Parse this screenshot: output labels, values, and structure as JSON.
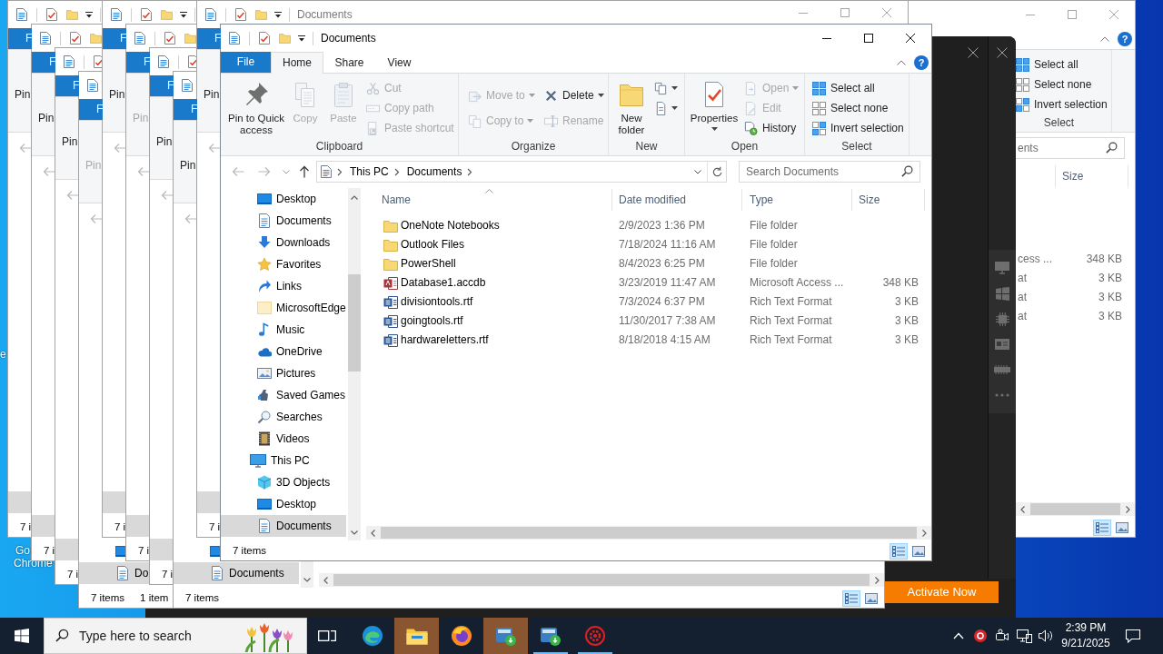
{
  "desktop_icons": [
    {
      "label_lines": [
        "e"
      ]
    },
    {
      "label_lines": [
        "Go",
        "Chrome"
      ]
    }
  ],
  "background_windows": [
    {
      "file_tab": "F",
      "ribbon_button": {
        "label": "Pin",
        "disabled": false
      },
      "nav_items": [
        {
          "selected": true
        }
      ],
      "status": [
        "7 i"
      ]
    },
    {
      "file_tab": "F",
      "ribbon_button": {
        "label": "Pin",
        "disabled": false
      },
      "nav_items": [
        {
          "selected": true
        }
      ],
      "status": [
        "7 i"
      ]
    },
    {
      "file_tab": "F",
      "ribbon_button": {
        "label": "Pin",
        "disabled": false
      },
      "nav_items": [
        {
          "selected": true
        }
      ],
      "status": [
        "7 i"
      ]
    },
    {
      "file_tab": "F",
      "ribbon_button": {
        "label": "Pin",
        "disabled": true
      },
      "nav_items": [
        {
          "selected": false
        },
        {
          "label": "Do",
          "selected": true
        }
      ],
      "status": [
        "7 items",
        "1 item"
      ]
    },
    {
      "file_tab": "F",
      "ribbon_button": {
        "label": "Pin",
        "disabled": false
      },
      "nav_items": [
        {
          "selected": true
        }
      ],
      "status": [
        "7 i"
      ]
    },
    {
      "file_tab": "F",
      "ribbon_button": {
        "label": "Pin",
        "disabled": true
      },
      "nav_items": [
        {
          "selected": true
        }
      ],
      "status": [
        "7 i"
      ]
    },
    {
      "file_tab": "F",
      "ribbon_button": {
        "label": "Pin",
        "disabled": false
      },
      "nav_items": [
        {
          "selected": true
        }
      ],
      "status": [
        "7 i"
      ]
    },
    {
      "file_tab": "F",
      "ribbon_button": {
        "label": "Pin",
        "disabled": false
      },
      "nav_items": [
        {
          "selected": false
        },
        {
          "label": "Documents",
          "selected": true
        }
      ],
      "status": [
        "7 items"
      ],
      "view_buttons": [
        {
          "selected": true
        },
        {
          "selected": false
        }
      ]
    },
    {
      "title": "Documents",
      "active": false,
      "file_tab": "F",
      "ribbon_button": {
        "label": "Pin",
        "disabled": false
      },
      "nav_items": [
        {
          "selected": true
        }
      ],
      "status": [
        "7 i"
      ]
    }
  ],
  "right_window": {
    "active": false,
    "help_button": "?",
    "ribbon_group": {
      "label": "Select",
      "buttons": [
        {
          "label": "Select all"
        },
        {
          "label": "Select none"
        },
        {
          "label": "Invert selection"
        }
      ]
    },
    "search": {
      "placeholder": "ents"
    },
    "columns": [
      {
        "label": "Size"
      }
    ],
    "rows": [
      {
        "type": "cess ...",
        "size": "348 KB",
        "selected": false
      },
      {
        "type": "at",
        "size": "3 KB",
        "selected": false
      },
      {
        "type": "at",
        "size": "3 KB",
        "selected": false
      },
      {
        "type": "at",
        "size": "3 KB",
        "selected": false
      }
    ],
    "view_buttons": [
      {
        "selected": true
      },
      {
        "selected": false
      }
    ]
  },
  "dark_app_window": {
    "action_button": "Activate Now"
  },
  "main_window": {
    "active": true,
    "title": "Documents",
    "help_button": "?",
    "tabs": [
      {
        "label": "File",
        "kind": "menu",
        "selected": false
      },
      {
        "label": "Home",
        "kind": "tab",
        "selected": true
      },
      {
        "label": "Share",
        "kind": "tab",
        "selected": false
      },
      {
        "label": "View",
        "kind": "tab",
        "selected": false
      }
    ],
    "ribbon": [
      {
        "label": "Clipboard",
        "buttons": [
          {
            "label": "Pin to Quick access",
            "kind": "large",
            "disabled": false,
            "dropdown": false
          },
          {
            "label": "Copy",
            "kind": "large",
            "disabled": true,
            "dropdown": false
          },
          {
            "label": "Paste",
            "kind": "large",
            "disabled": true,
            "dropdown": false
          },
          {
            "label": "Cut",
            "kind": "small",
            "disabled": true,
            "dropdown": false
          },
          {
            "label": "Copy path",
            "kind": "small",
            "disabled": true,
            "dropdown": false
          },
          {
            "label": "Paste shortcut",
            "kind": "small",
            "disabled": true,
            "dropdown": false
          }
        ]
      },
      {
        "label": "Organize",
        "buttons": [
          {
            "label": "Move to",
            "kind": "small",
            "disabled": true,
            "dropdown": true
          },
          {
            "label": "Copy to",
            "kind": "small",
            "disabled": true,
            "dropdown": true
          },
          {
            "label": "Delete",
            "kind": "small",
            "disabled": false,
            "dropdown": true
          },
          {
            "label": "Rename",
            "kind": "small",
            "disabled": true,
            "dropdown": false
          }
        ]
      },
      {
        "label": "New",
        "buttons": [
          {
            "label": "New folder",
            "kind": "large",
            "disabled": false,
            "dropdown": false
          },
          {
            "kind": "icon",
            "disabled": false,
            "dropdown": true
          },
          {
            "kind": "icon",
            "disabled": false,
            "dropdown": true
          }
        ]
      },
      {
        "label": "Open",
        "buttons": [
          {
            "label": "Properties",
            "kind": "large",
            "disabled": false,
            "dropdown": true
          },
          {
            "label": "Open",
            "kind": "small",
            "disabled": true,
            "dropdown": true
          },
          {
            "label": "Edit",
            "kind": "small",
            "disabled": true,
            "dropdown": false
          },
          {
            "label": "History",
            "kind": "small",
            "disabled": false,
            "dropdown": false
          }
        ]
      },
      {
        "label": "Select",
        "buttons": [
          {
            "label": "Select all",
            "kind": "small",
            "disabled": false,
            "dropdown": false
          },
          {
            "label": "Select none",
            "kind": "small",
            "disabled": false,
            "dropdown": false
          },
          {
            "label": "Invert selection",
            "kind": "small",
            "disabled": false,
            "dropdown": false
          }
        ]
      }
    ],
    "address": {
      "path": [
        "This PC",
        "Documents"
      ]
    },
    "search": {
      "placeholder": "Search Documents"
    },
    "nav_pane": [
      {
        "children": [
          {
            "label": "Desktop",
            "selected": false
          },
          {
            "label": "Documents",
            "selected": false
          },
          {
            "label": "Downloads",
            "selected": false
          },
          {
            "label": "Favorites",
            "selected": false
          },
          {
            "label": "Links",
            "selected": false
          },
          {
            "label": "MicrosoftEdge",
            "selected": false
          },
          {
            "label": "Music",
            "selected": false
          },
          {
            "label": "OneDrive",
            "selected": false
          },
          {
            "label": "Pictures",
            "selected": false
          },
          {
            "label": "Saved Games",
            "selected": false
          },
          {
            "label": "Searches",
            "selected": false
          },
          {
            "label": "Videos",
            "selected": false
          }
        ]
      },
      {
        "label": "This PC",
        "selected": false,
        "children": [
          {
            "label": "3D Objects",
            "selected": false
          },
          {
            "label": "Desktop",
            "selected": false
          },
          {
            "label": "Documents",
            "selected": true
          }
        ]
      }
    ],
    "file_list": {
      "columns": [
        {
          "label": "Name",
          "sorted": true
        },
        {
          "label": "Date modified",
          "sorted": false
        },
        {
          "label": "Type",
          "sorted": false
        },
        {
          "label": "Size",
          "sorted": false
        }
      ],
      "rows": [
        {
          "name": "OneNote Notebooks",
          "date_modified": "2/9/2023 1:36 PM",
          "type": "File folder",
          "selected": false
        },
        {
          "name": "Outlook Files",
          "date_modified": "7/18/2024 11:16 AM",
          "type": "File folder",
          "selected": false
        },
        {
          "name": "PowerShell",
          "date_modified": "8/4/2023 6:25 PM",
          "type": "File folder",
          "selected": false
        },
        {
          "name": "Database1.accdb",
          "date_modified": "3/23/2019 11:47 AM",
          "type": "Microsoft Access ...",
          "size": "348 KB",
          "selected": false
        },
        {
          "name": "divisiontools.rtf",
          "date_modified": "7/3/2024 6:37 PM",
          "type": "Rich Text Format",
          "size": "3 KB",
          "selected": false
        },
        {
          "name": "goingtools.rtf",
          "date_modified": "11/30/2017 7:38 AM",
          "type": "Rich Text Format",
          "size": "3 KB",
          "selected": false
        },
        {
          "name": "hardwareletters.rtf",
          "date_modified": "8/18/2018 4:15 AM",
          "type": "Rich Text Format",
          "size": "3 KB",
          "selected": false
        }
      ]
    },
    "status": "7 items",
    "view_buttons": [
      {
        "selected": true
      },
      {
        "selected": false
      }
    ]
  },
  "taskbar": {
    "search": {
      "placeholder": "Type here to search"
    },
    "apps": [
      {
        "active": false,
        "running": false
      },
      {
        "active": true,
        "running": false
      },
      {
        "active": false,
        "running": false
      },
      {
        "active": true,
        "running": false
      },
      {
        "active": false,
        "running": true
      },
      {
        "active": false,
        "running": true
      }
    ],
    "clock": {
      "time": "2:39 PM",
      "date": "9/21/2025"
    }
  }
}
